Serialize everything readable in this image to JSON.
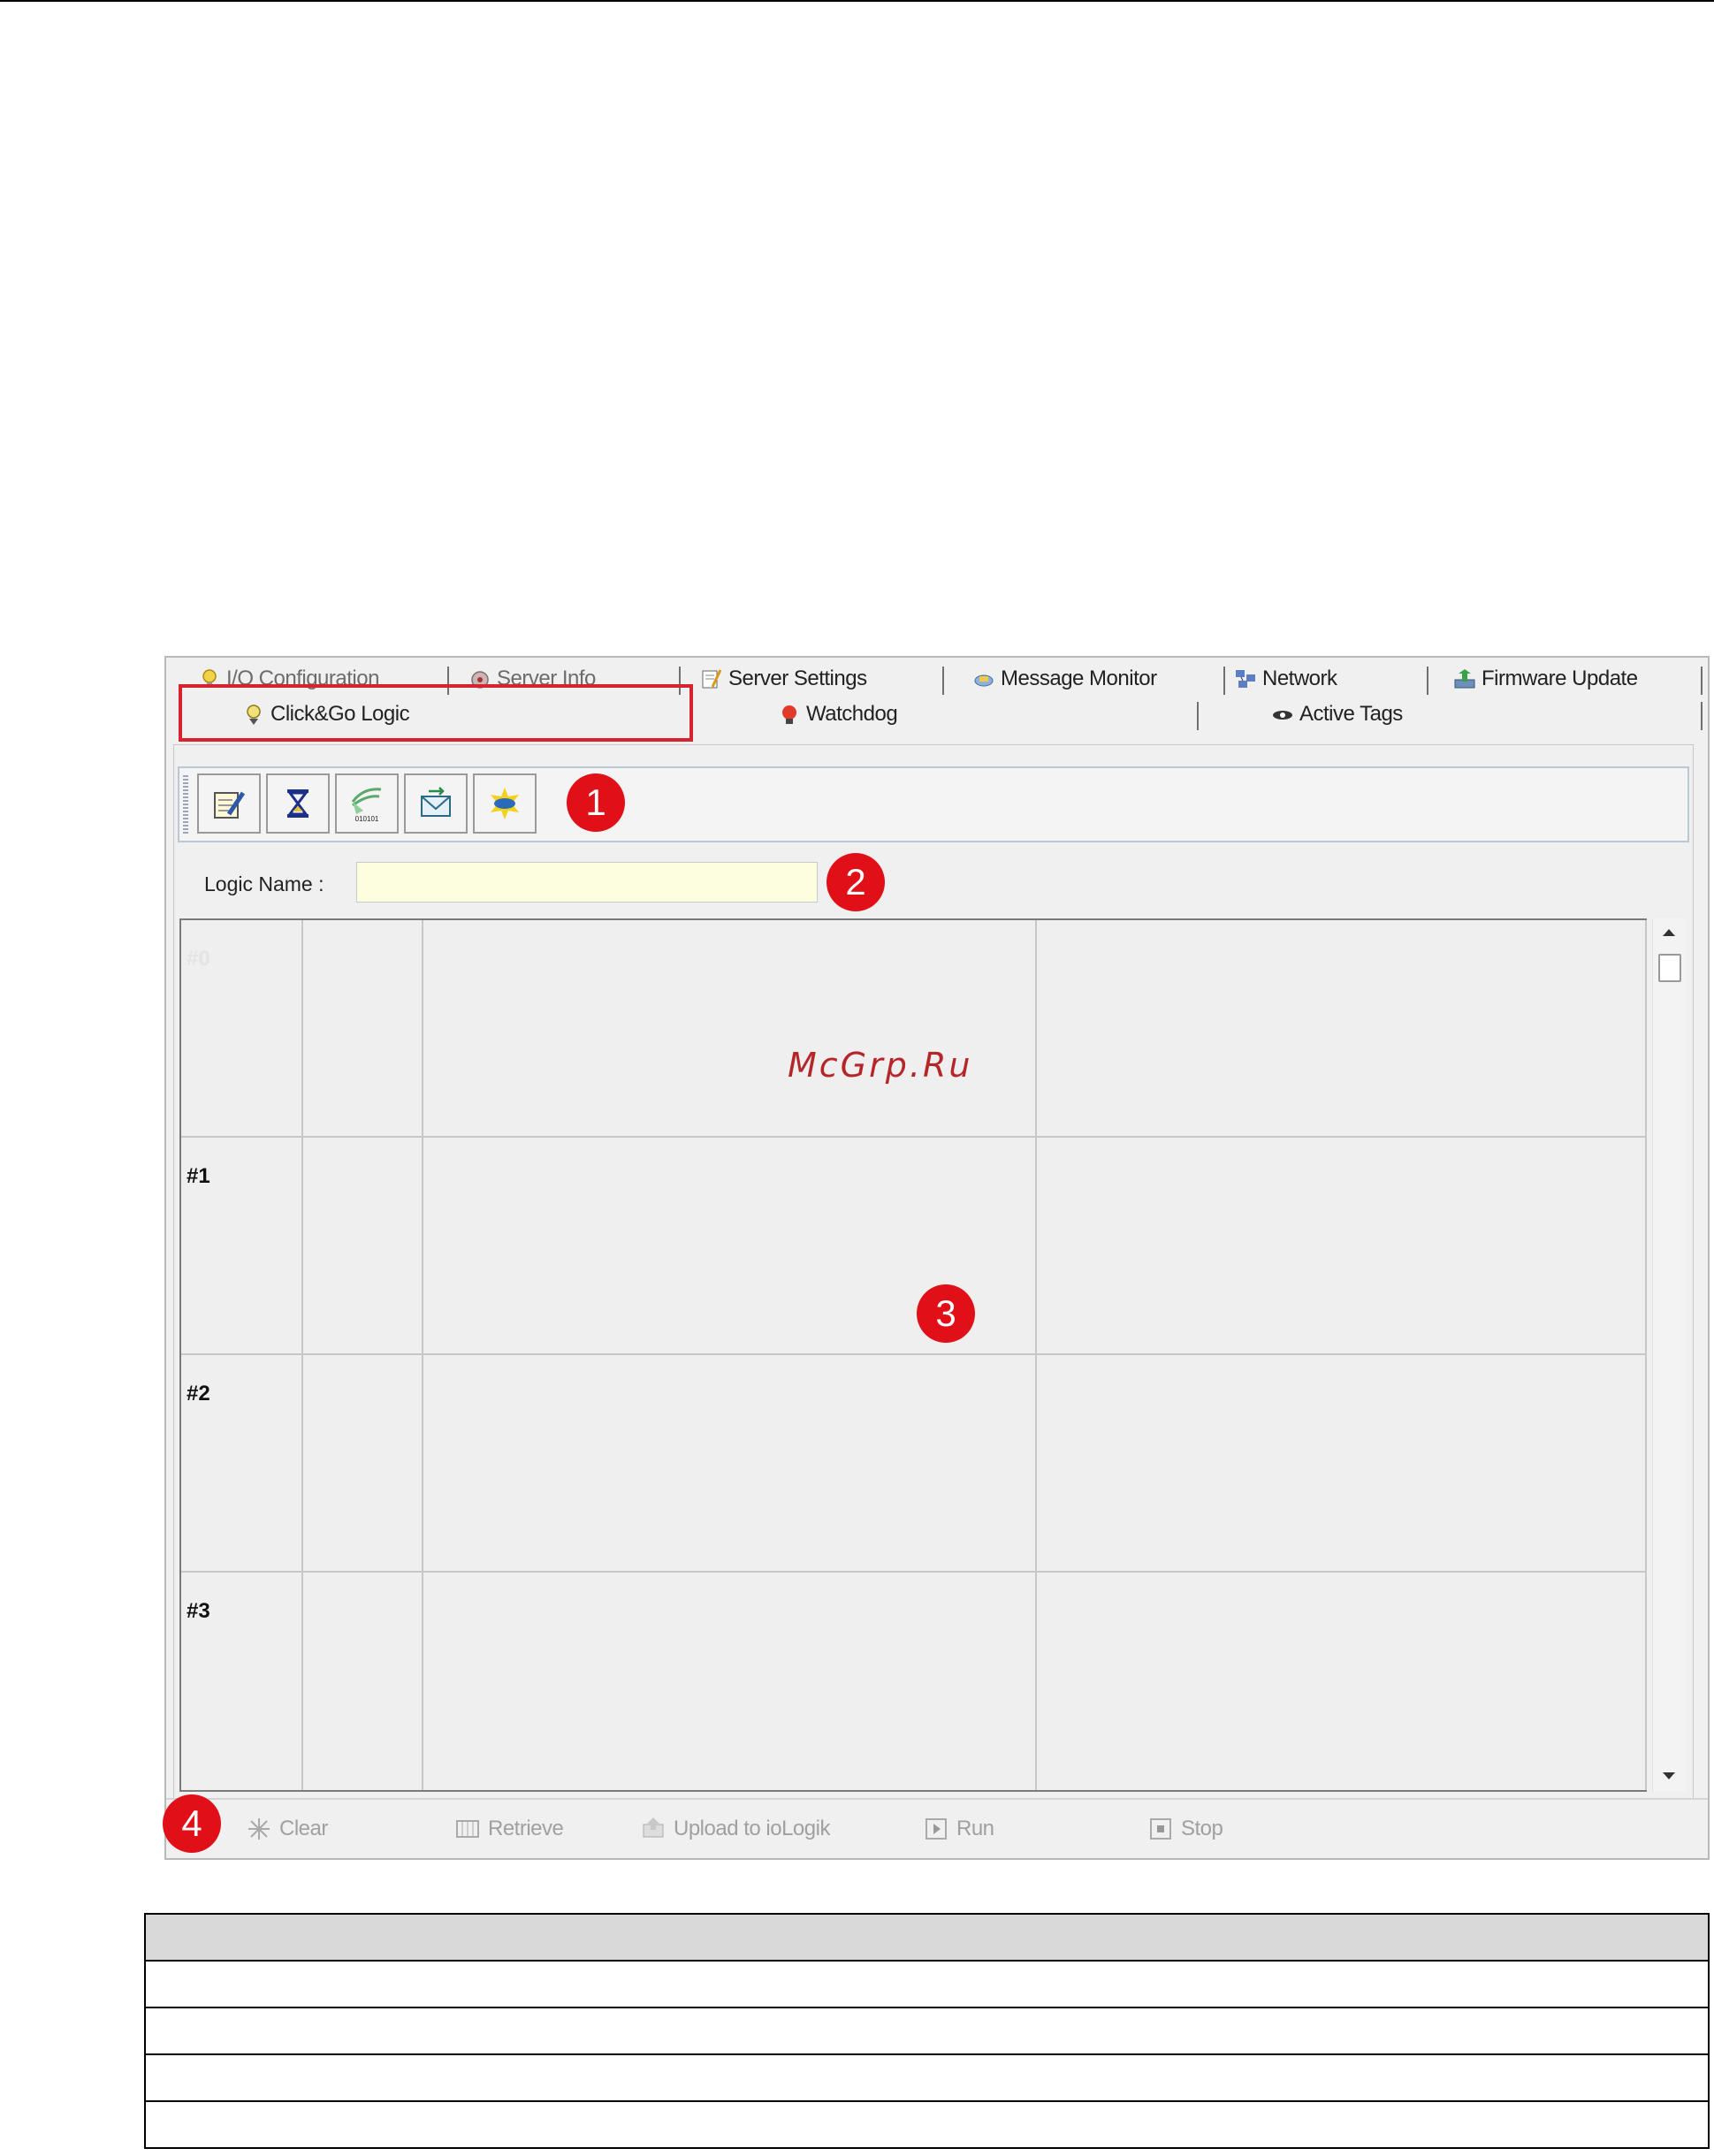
{
  "tabs": {
    "row1": [
      {
        "label": "I/O Configuration",
        "icon": "bulb-icon"
      },
      {
        "label": "Server Info",
        "icon": "server-info-icon"
      },
      {
        "label": "Server Settings",
        "icon": "server-settings-icon"
      },
      {
        "label": "Message Monitor",
        "icon": "message-monitor-icon"
      },
      {
        "label": "Network",
        "icon": "network-icon"
      },
      {
        "label": "Firmware Update",
        "icon": "firmware-update-icon"
      }
    ],
    "row2": [
      {
        "label": "Click&Go Logic",
        "icon": "click-go-logic-icon",
        "selected": true
      },
      {
        "label": "Watchdog",
        "icon": "watchdog-icon"
      },
      {
        "label": "Active Tags",
        "icon": "active-tags-icon"
      }
    ]
  },
  "toolbar": {
    "buttons": [
      {
        "icon": "edit-icon"
      },
      {
        "icon": "timer-icon"
      },
      {
        "icon": "binary-signal-icon",
        "caption": "010101"
      },
      {
        "icon": "email-icon"
      },
      {
        "icon": "snmp-trap-icon"
      }
    ]
  },
  "logic": {
    "label": "Logic Name :",
    "value": ""
  },
  "grid": {
    "rows": [
      "#0",
      "#1",
      "#2",
      "#3"
    ]
  },
  "callouts": [
    "1",
    "2",
    "3",
    "4"
  ],
  "watermark": "McGrp.Ru",
  "actions": [
    {
      "label": "Clear",
      "icon": "clear-icon"
    },
    {
      "label": "Retrieve",
      "icon": "retrieve-icon"
    },
    {
      "label": "Upload to ioLogik",
      "icon": "upload-icon"
    },
    {
      "label": "Run",
      "icon": "run-icon"
    },
    {
      "label": "Stop",
      "icon": "stop-icon"
    }
  ],
  "colors": {
    "callout": "#e10f17",
    "highlight": "#d6232e",
    "input_bg": "#fdfde0"
  }
}
